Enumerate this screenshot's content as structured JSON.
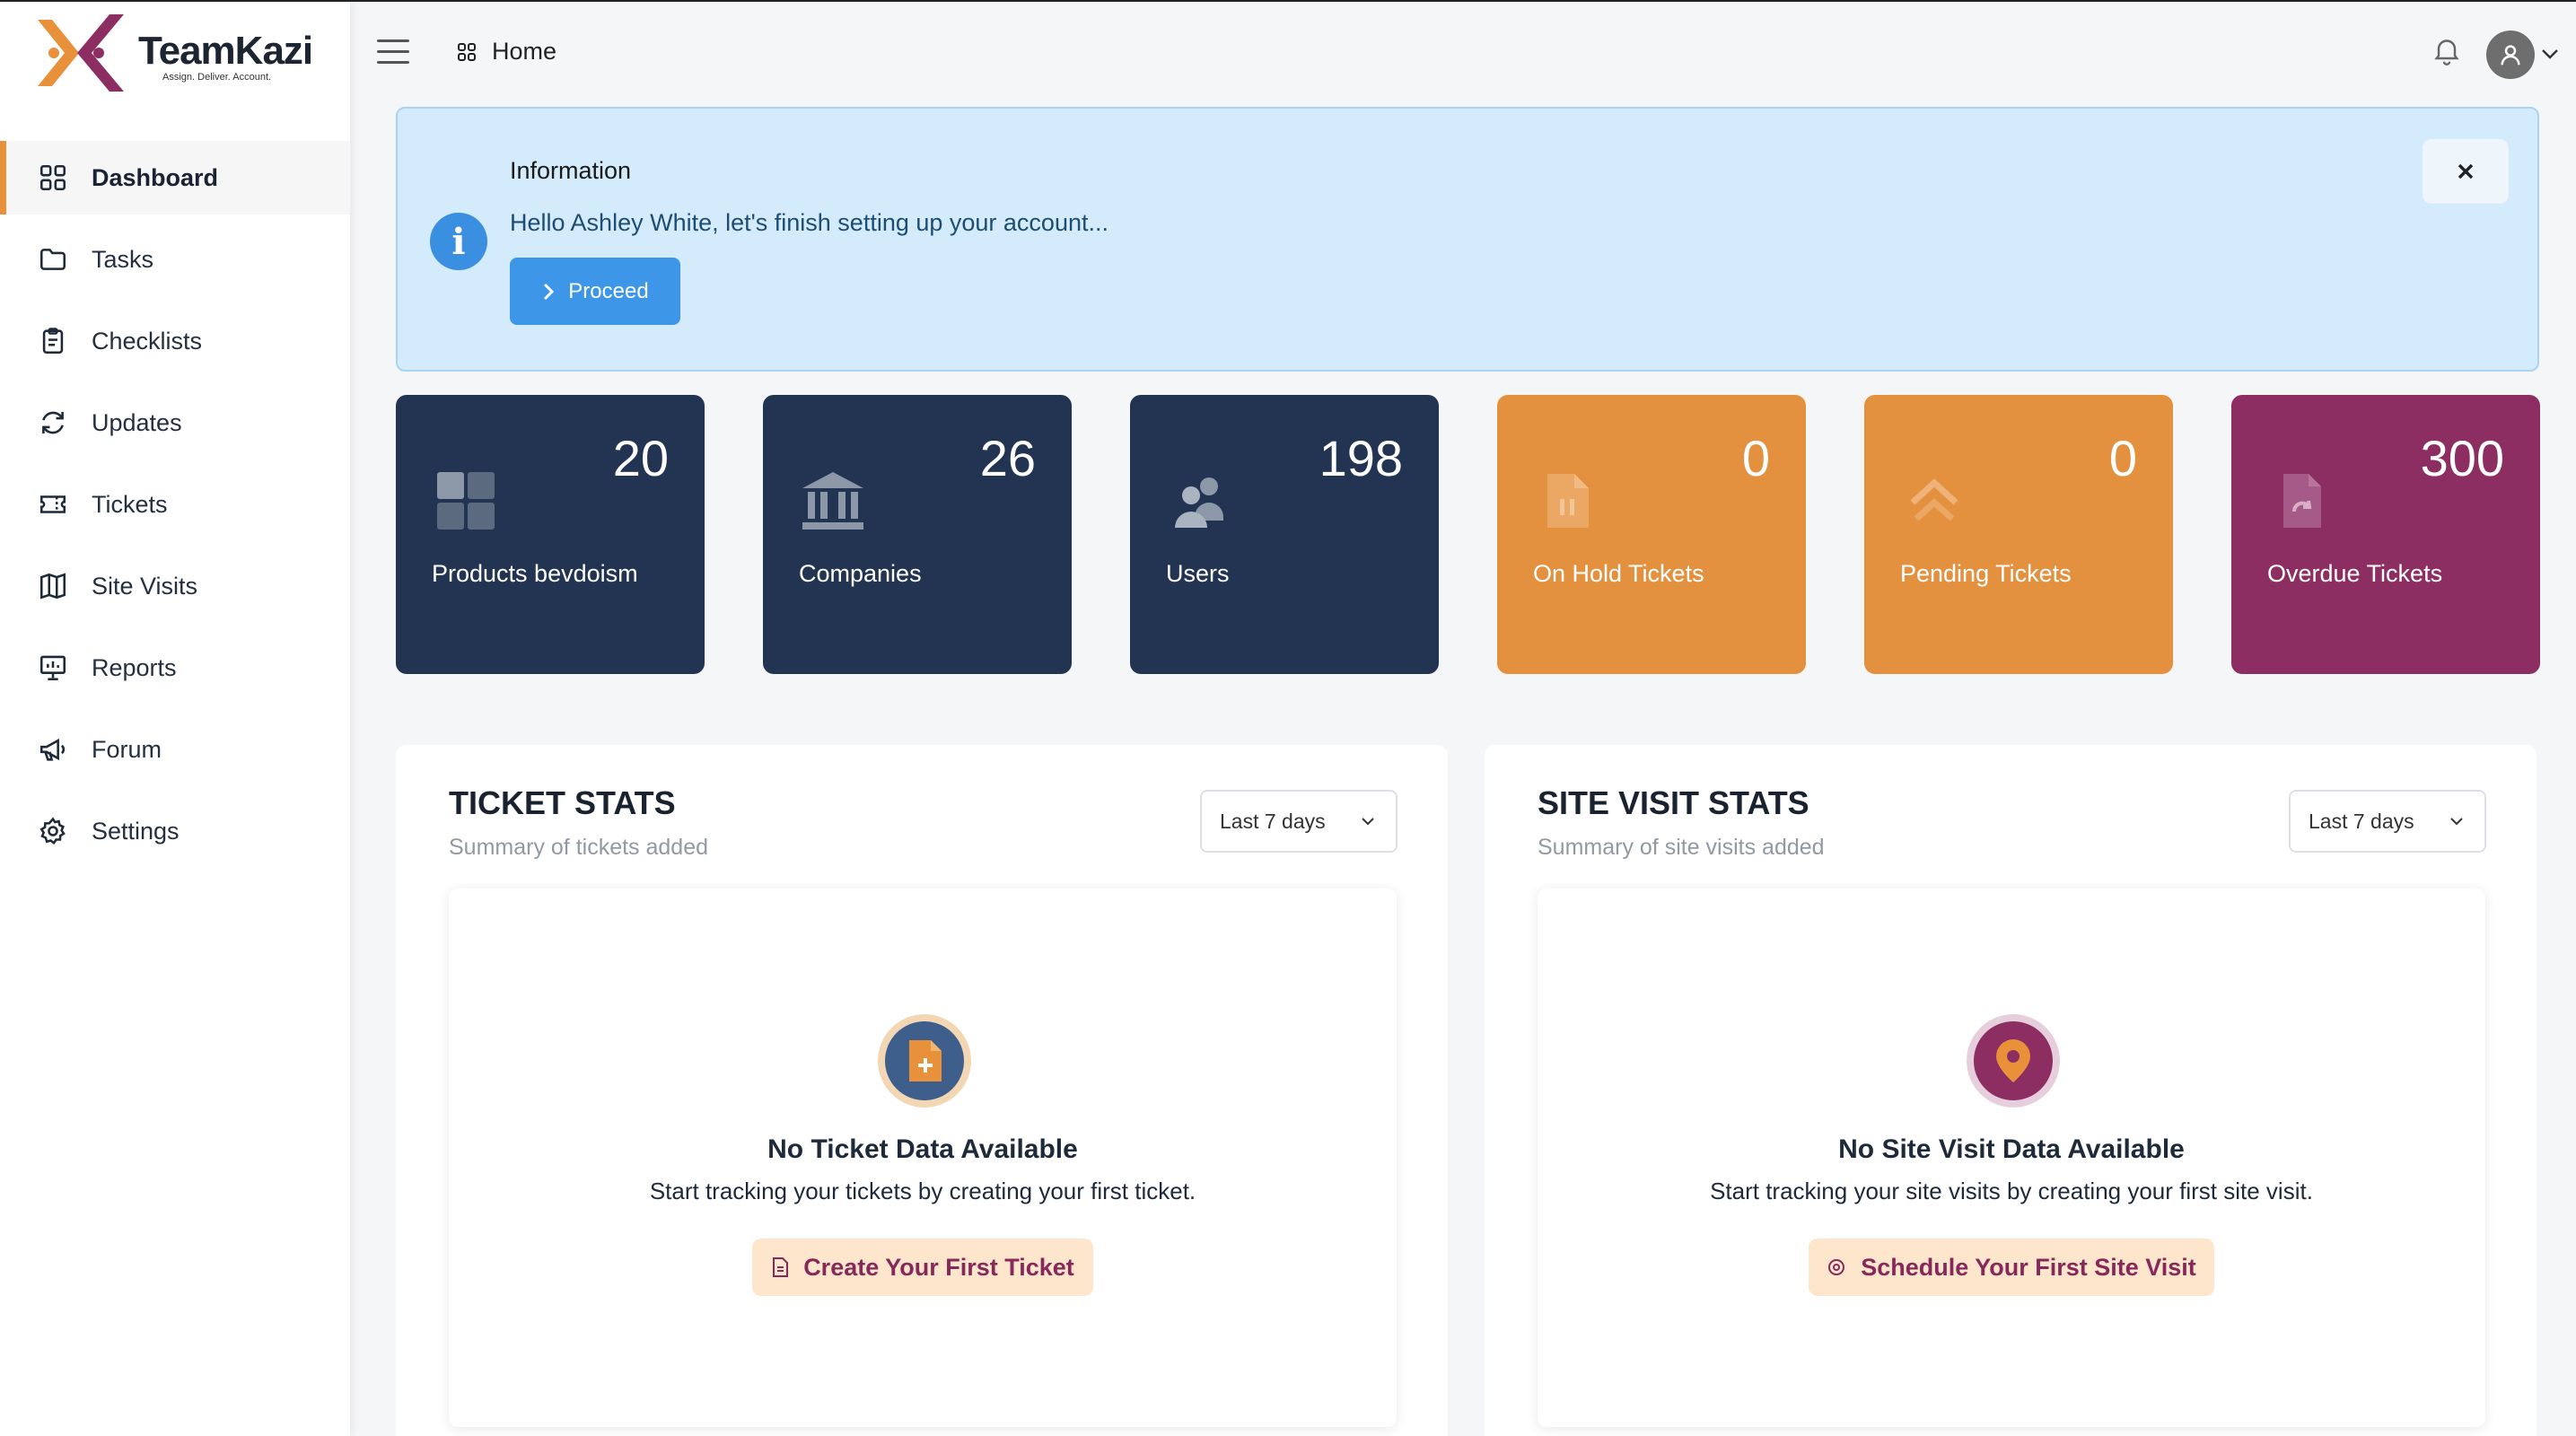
{
  "app": {
    "name": "TeamKazi",
    "tagline": "Assign. Deliver. Account.",
    "brand_colors": {
      "orange": "#e8913a",
      "plum": "#8d2e63",
      "navy": "#233453"
    }
  },
  "sidebar": {
    "items": [
      {
        "label": "Dashboard",
        "icon": "dashboard-grid-icon",
        "active": true
      },
      {
        "label": "Tasks",
        "icon": "folder-icon",
        "active": false
      },
      {
        "label": "Checklists",
        "icon": "clipboard-icon",
        "active": false
      },
      {
        "label": "Updates",
        "icon": "refresh-icon",
        "active": false
      },
      {
        "label": "Tickets",
        "icon": "ticket-icon",
        "active": false
      },
      {
        "label": "Site Visits",
        "icon": "map-icon",
        "active": false
      },
      {
        "label": "Reports",
        "icon": "presentation-chart-icon",
        "active": false
      },
      {
        "label": "Forum",
        "icon": "megaphone-icon",
        "active": false
      },
      {
        "label": "Settings",
        "icon": "gear-icon",
        "active": false
      }
    ]
  },
  "header": {
    "breadcrumb": "Home"
  },
  "info_banner": {
    "title": "Information",
    "message": "Hello Ashley White, let's finish setting up your account...",
    "button_label": "Proceed"
  },
  "stats": [
    {
      "value": "20",
      "label": "Products bevdoism",
      "icon": "grid-icon",
      "color": "#233453"
    },
    {
      "value": "26",
      "label": "Companies",
      "icon": "bank-icon",
      "color": "#233453"
    },
    {
      "value": "198",
      "label": "Users",
      "icon": "users-icon",
      "color": "#233453"
    },
    {
      "value": "0",
      "label": "On Hold Tickets",
      "icon": "document-pause-icon",
      "color": "#e3913f"
    },
    {
      "value": "0",
      "label": "Pending Tickets",
      "icon": "double-chevron-up-icon",
      "color": "#e3913f"
    },
    {
      "value": "300",
      "label": "Overdue Tickets",
      "icon": "document-refresh-icon",
      "color": "#8d2e63"
    }
  ],
  "ticket_stats": {
    "title": "TICKET STATS",
    "subtitle": "Summary of tickets added",
    "range": "Last 7 days",
    "empty_title": "No Ticket Data Available",
    "empty_desc": "Start tracking your tickets by creating your first ticket.",
    "cta_label": "Create Your First Ticket"
  },
  "site_visit_stats": {
    "title": "SITE VISIT STATS",
    "subtitle": "Summary of site visits added",
    "range": "Last 7 days",
    "empty_title": "No Site Visit Data Available",
    "empty_desc": "Start tracking your site visits by creating your first site visit.",
    "cta_label": "Schedule Your First Site Visit"
  }
}
